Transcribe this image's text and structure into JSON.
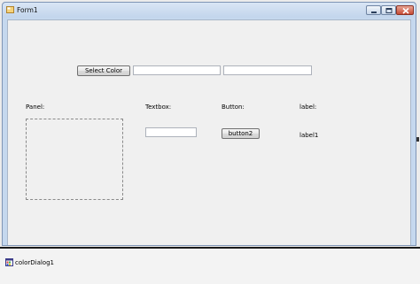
{
  "form": {
    "title": "Form1",
    "select_color_button": "Select Color",
    "labels": {
      "panel": "Panel:",
      "textbox": "Textbox:",
      "button": "Button:",
      "label": "label:"
    },
    "button2": "button2",
    "label1": "label1"
  },
  "component_tray": {
    "items": [
      {
        "name": "colorDialog1",
        "icon": "color-dialog-icon"
      }
    ]
  },
  "colors": {
    "titlebar": "#c2d5ec",
    "client": "#f0f0f0",
    "close_button": "#c74a34"
  }
}
